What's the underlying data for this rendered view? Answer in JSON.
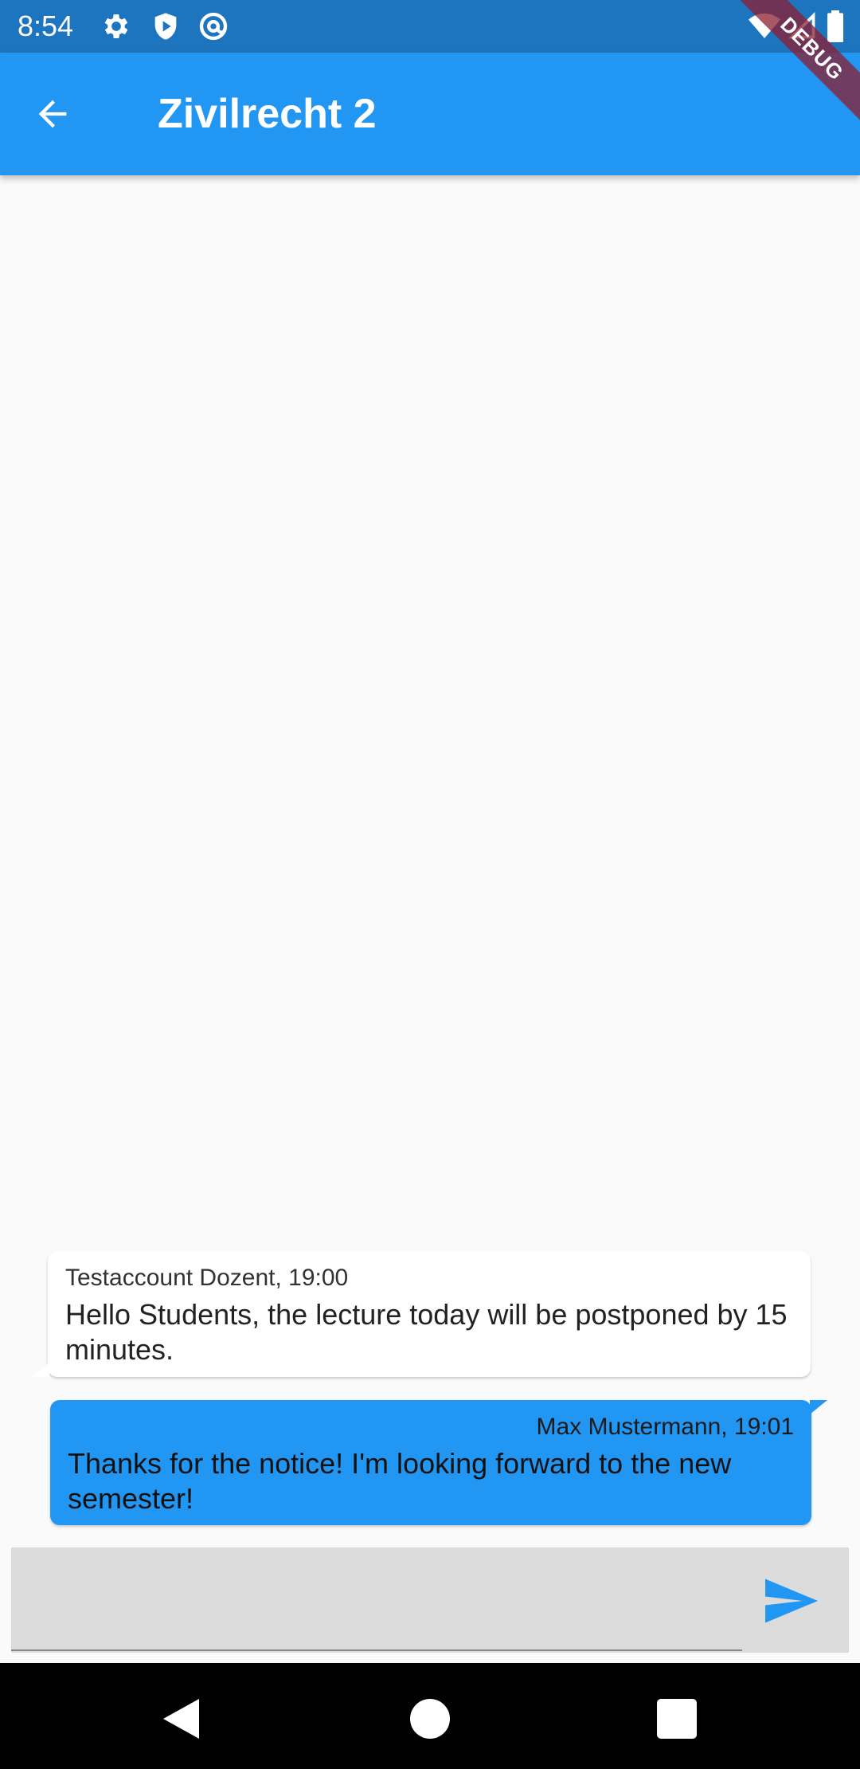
{
  "status_bar": {
    "time": "8:54",
    "left_icons": [
      "gear-icon",
      "shield-play-icon",
      "at-circle-icon"
    ],
    "right_icons": [
      "wifi-icon",
      "cell-signal-icon",
      "battery-icon"
    ]
  },
  "debug_banner": "DEBUG",
  "app_bar": {
    "title": "Zivilrecht 2",
    "back_icon": "arrow-left-icon",
    "color": "#2196f3"
  },
  "messages": [
    {
      "direction": "incoming",
      "meta": "Testaccount Dozent, 19:00",
      "text": "Hello Students, the lecture today will be postponed by 15 minutes."
    },
    {
      "direction": "outgoing",
      "meta": "Max Mustermann, 19:01",
      "text": "Thanks for the notice! I'm looking forward to the new semester!"
    }
  ],
  "composer": {
    "value": "",
    "send_icon": "send-icon"
  },
  "nav_bar": {
    "buttons": [
      "back-triangle-icon",
      "home-circle-icon",
      "recents-square-icon"
    ]
  }
}
